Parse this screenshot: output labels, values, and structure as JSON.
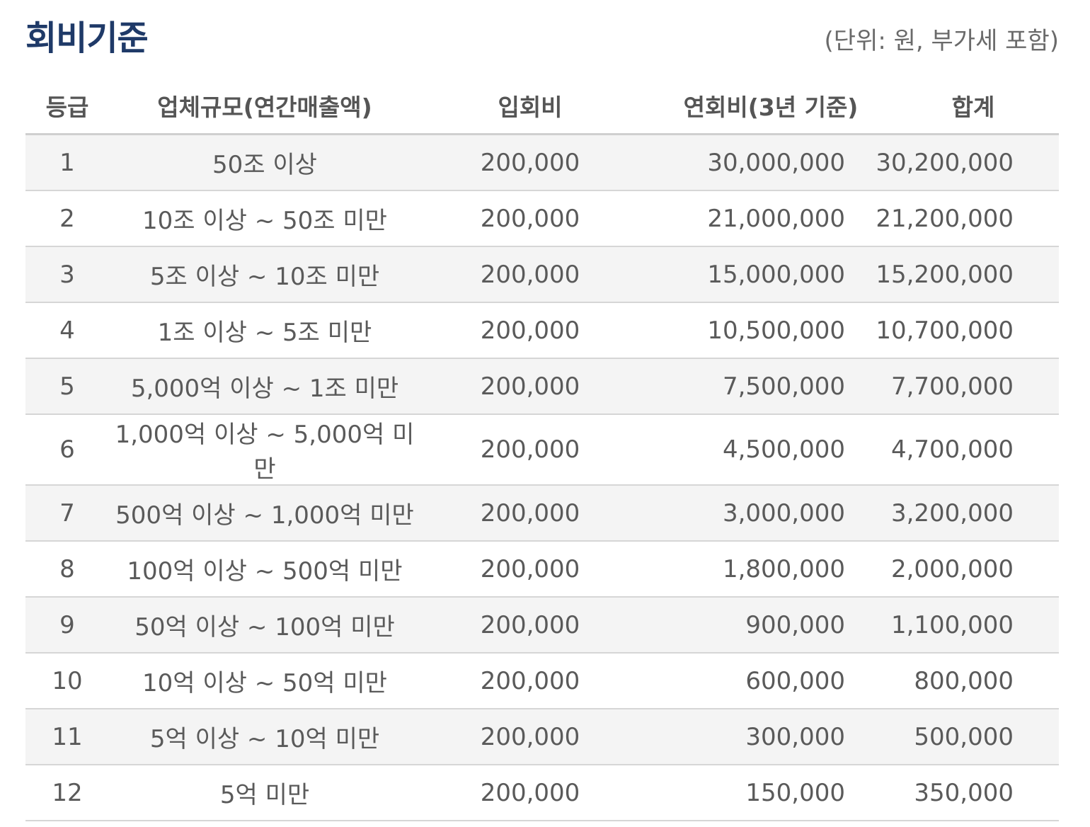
{
  "header": {
    "title": "회비기준",
    "unit_note": "(단위: 원, 부가세 포함)"
  },
  "table": {
    "columns": [
      "등급",
      "업체규모(연간매출액)",
      "입회비",
      "연회비(3년 기준)",
      "합계"
    ],
    "rows": [
      [
        "1",
        "50조 이상",
        "200,000",
        "30,000,000",
        "30,200,000"
      ],
      [
        "2",
        "10조 이상 ~ 50조 미만",
        "200,000",
        "21,000,000",
        "21,200,000"
      ],
      [
        "3",
        "5조 이상 ~ 10조 미만",
        "200,000",
        "15,000,000",
        "15,200,000"
      ],
      [
        "4",
        "1조 이상 ~ 5조 미만",
        "200,000",
        "10,500,000",
        "10,700,000"
      ],
      [
        "5",
        "5,000억 이상 ~ 1조 미만",
        "200,000",
        "7,500,000",
        "7,700,000"
      ],
      [
        "6",
        "1,000억 이상 ~ 5,000억 미만",
        "200,000",
        "4,500,000",
        "4,700,000"
      ],
      [
        "7",
        "500억 이상 ~ 1,000억 미만",
        "200,000",
        "3,000,000",
        "3,200,000"
      ],
      [
        "8",
        "100억 이상 ~ 500억 미만",
        "200,000",
        "1,800,000",
        "2,000,000"
      ],
      [
        "9",
        "50억 이상 ~ 100억 미만",
        "200,000",
        "900,000",
        "1,100,000"
      ],
      [
        "10",
        "10억 이상 ~ 50억 미만",
        "200,000",
        "600,000",
        "800,000"
      ],
      [
        "11",
        "5억 이상 ~ 10억 미만",
        "200,000",
        "300,000",
        "500,000"
      ],
      [
        "12",
        "5억 미만",
        "200,000",
        "150,000",
        "350,000"
      ]
    ]
  },
  "colors": {
    "title": "#1f3a68",
    "text": "#555555",
    "row_shade": "#f4f4f4",
    "border": "#d6d6d6"
  }
}
